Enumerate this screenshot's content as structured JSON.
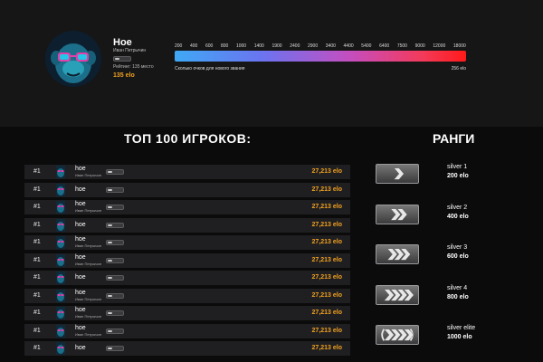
{
  "profile": {
    "name": "Hoe",
    "real_name": "Иван Петрычин",
    "rating_text": "Рейтинг: 135 место",
    "elo": "135 elo"
  },
  "progress": {
    "scale": [
      "200",
      "400",
      "600",
      "800",
      "1000",
      "1400",
      "1900",
      "2400",
      "2900",
      "3400",
      "4400",
      "5400",
      "6400",
      "7500",
      "9000",
      "12000",
      "18000"
    ],
    "note": "Сколько очков для нового звания",
    "right_value": "256 elo",
    "colors": {
      "start": "#3fa9f5",
      "mid": "#c44ec0",
      "end": "#ff1a1a"
    }
  },
  "sections": {
    "top_title": "ТОП 100 ИГРОКОВ:",
    "ranks_title": "РАНГИ"
  },
  "players": [
    {
      "pos": "#1",
      "name": "hoe",
      "sub": "Иван Петрычин",
      "elo": "27,213 elo"
    },
    {
      "pos": "#1",
      "name": "hoe",
      "sub": "",
      "elo": "27,213 elo"
    },
    {
      "pos": "#1",
      "name": "hoe",
      "sub": "Иван Петрычин",
      "elo": "27,213 elo"
    },
    {
      "pos": "#1",
      "name": "hoe",
      "sub": "",
      "elo": "27,213 elo"
    },
    {
      "pos": "#1",
      "name": "hoe",
      "sub": "Иван Петрычин",
      "elo": "27,213 elo"
    },
    {
      "pos": "#1",
      "name": "hoe",
      "sub": "Иван Петрычин",
      "elo": "27,213 elo"
    },
    {
      "pos": "#1",
      "name": "hoe",
      "sub": "",
      "elo": "27,213 elo"
    },
    {
      "pos": "#1",
      "name": "hoe",
      "sub": "Иван Петрычин",
      "elo": "27,213 elo"
    },
    {
      "pos": "#1",
      "name": "hoe",
      "sub": "Иван Петрычин",
      "elo": "27,213 elo"
    },
    {
      "pos": "#1",
      "name": "hoe",
      "sub": "Иван Петрычин",
      "elo": "27,213 elo"
    },
    {
      "pos": "#1",
      "name": "hoe",
      "sub": "",
      "elo": "27,213 elo"
    }
  ],
  "ranks": [
    {
      "name": "silver 1",
      "elo": "200 elo",
      "chevrons": 1
    },
    {
      "name": "silver 2",
      "elo": "400 elo",
      "chevrons": 2
    },
    {
      "name": "silver 3",
      "elo": "600 elo",
      "chevrons": 3
    },
    {
      "name": "silver 4",
      "elo": "800 elo",
      "chevrons": 4
    },
    {
      "name": "silver elite",
      "elo": "1000 elo",
      "chevrons": 4
    }
  ],
  "accent_color": "#f0a021"
}
